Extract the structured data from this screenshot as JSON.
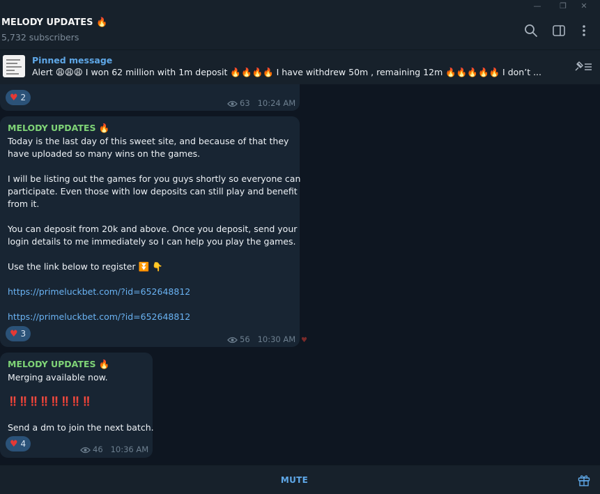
{
  "colors": {
    "background": "#0e1621",
    "panel": "#17212b",
    "bubble": "#182533",
    "accent": "#5fa8e8",
    "sender": "#7fd477",
    "link": "#6ab3f3",
    "reaction": "#2b5278"
  },
  "window": {
    "minimize_icon": "minimize-icon",
    "restore_icon": "restore-icon",
    "close_icon": "close-icon"
  },
  "header": {
    "title": "MELODY UPDATES 🔥",
    "subscribers": "5,732 subscribers",
    "icons": [
      "search-icon",
      "sidebar-toggle-icon",
      "more-vertical-icon"
    ]
  },
  "pinned": {
    "label": "Pinned message",
    "text": "Alert 😩😩😩  I won 62 million with 1m deposit 🔥🔥🔥🔥  I have withdrew 50m , remaining 12m 🔥🔥🔥🔥🔥  I don’t ..."
  },
  "messages": [
    {
      "reaction": {
        "emoji": "♥",
        "count": "2"
      },
      "views": "63",
      "time": "10:24 AM"
    },
    {
      "sender": "MELODY UPDATES 🔥",
      "lines": [
        "Today is the last day of this sweet site, and because of that they",
        "have uploaded so many wins on the games.",
        "I will be listing out the games for you guys shortly so everyone can",
        "participate. Even those with low deposits can still play and benefit",
        "from it.",
        "You can deposit from 20k and above. Once you deposit, send your",
        "login details to me immediately so I can help you play the games.",
        "Use the link below to register ⏬ 👇"
      ],
      "links": [
        "https://primeluckbet.com/?id=652648812",
        "https://primeluckbet.com/?id=652648812"
      ],
      "reaction": {
        "emoji": "♥",
        "count": "3"
      },
      "views": "56",
      "time": "10:30 AM"
    },
    {
      "sender": "MELODY UPDATES 🔥",
      "lines": [
        "Merging available now.",
        "‼️‼️‼️‼️‼️‼️‼️‼️",
        "Send a dm to join the next batch."
      ],
      "reaction": {
        "emoji": "♥",
        "count": "4"
      },
      "views": "46",
      "time": "10:36 AM"
    }
  ],
  "footer": {
    "mute_label": "MUTE",
    "gift_icon": "gift-icon"
  }
}
